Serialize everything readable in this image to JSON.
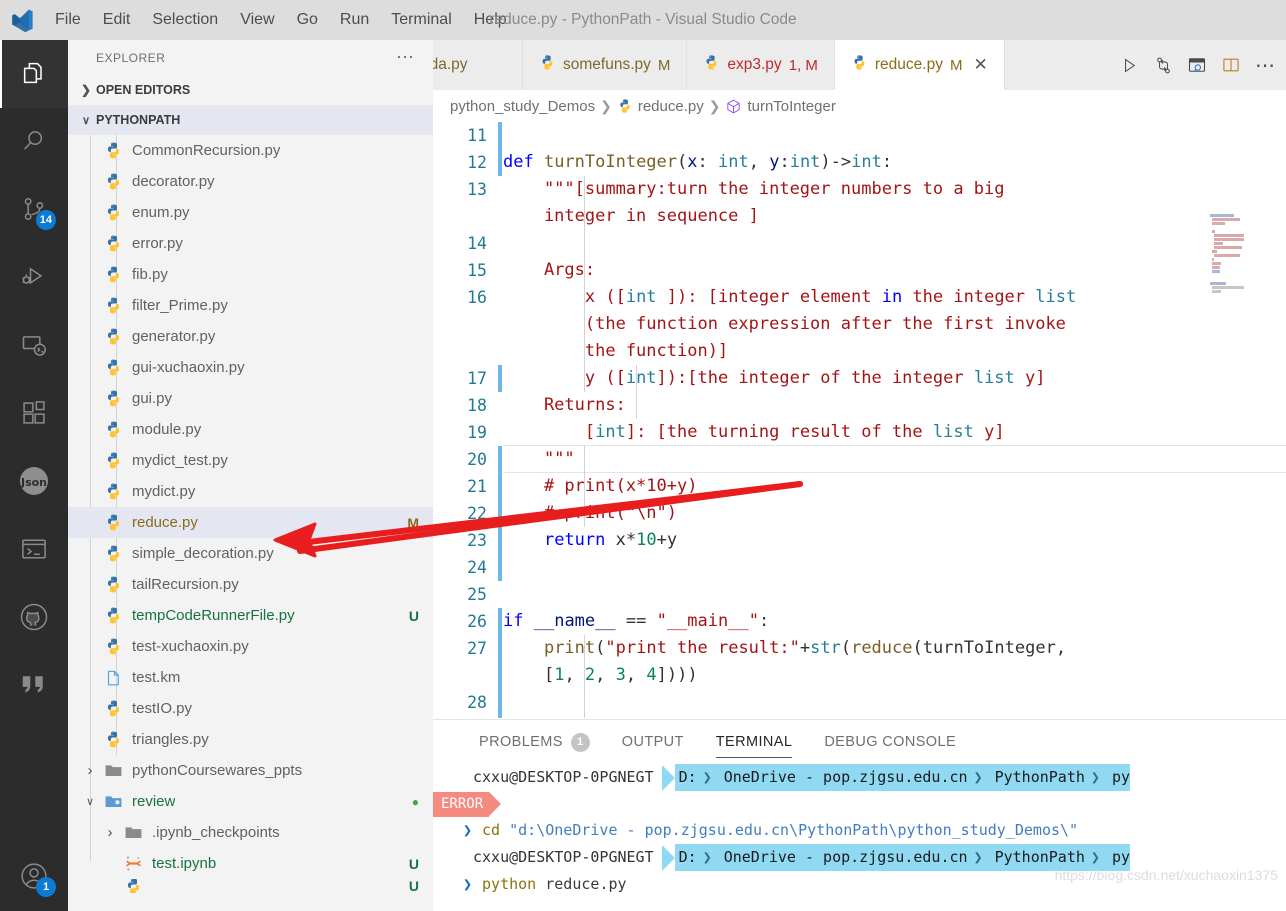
{
  "window": {
    "title": "reduce.py - PythonPath - Visual Studio Code",
    "logo_icon": "vscode-logo-icon"
  },
  "menubar": {
    "items": [
      {
        "label": "File"
      },
      {
        "label": "Edit"
      },
      {
        "label": "Selection"
      },
      {
        "label": "View"
      },
      {
        "label": "Go"
      },
      {
        "label": "Run"
      },
      {
        "label": "Terminal"
      },
      {
        "label": "Help"
      }
    ]
  },
  "activitybar": {
    "items": [
      {
        "icon": "files-explorer-icon",
        "active": true,
        "badge": ""
      },
      {
        "icon": "search-icon",
        "active": false,
        "badge": ""
      },
      {
        "icon": "source-control-icon",
        "active": false,
        "badge": "14"
      },
      {
        "icon": "run-and-debug-icon",
        "active": false,
        "badge": ""
      },
      {
        "icon": "remote-explorer-icon",
        "active": false,
        "badge": ""
      },
      {
        "icon": "extensions-icon",
        "active": false,
        "badge": ""
      },
      {
        "icon": "json-icon",
        "active": false,
        "badge": ""
      },
      {
        "icon": "terminal-icon",
        "active": false,
        "badge": ""
      },
      {
        "icon": "github-icon",
        "active": false,
        "badge": ""
      },
      {
        "icon": "quote-bookmarks-icon",
        "active": false,
        "badge": ""
      }
    ],
    "bottom": [
      {
        "icon": "accounts-icon",
        "badge": "1"
      }
    ]
  },
  "sidebar": {
    "header": "EXPLORER",
    "more_icon": "ellipsis-icon",
    "sections": [
      {
        "label": "OPEN EDITORS",
        "expanded": false
      },
      {
        "label": "PYTHONPATH",
        "expanded": true
      }
    ],
    "files": [
      {
        "name": "CommonRecursion.py",
        "icon": "python-file-icon",
        "badge": "",
        "state": "normal",
        "depth": 2,
        "type": "file"
      },
      {
        "name": "decorator.py",
        "icon": "python-file-icon",
        "badge": "",
        "state": "normal",
        "depth": 2,
        "type": "file"
      },
      {
        "name": "enum.py",
        "icon": "python-file-icon",
        "badge": "",
        "state": "normal",
        "depth": 2,
        "type": "file"
      },
      {
        "name": "error.py",
        "icon": "python-file-icon",
        "badge": "",
        "state": "normal",
        "depth": 2,
        "type": "file"
      },
      {
        "name": "fib.py",
        "icon": "python-file-icon",
        "badge": "",
        "state": "normal",
        "depth": 2,
        "type": "file"
      },
      {
        "name": "filter_Prime.py",
        "icon": "python-file-icon",
        "badge": "",
        "state": "normal",
        "depth": 2,
        "type": "file"
      },
      {
        "name": "generator.py",
        "icon": "python-file-icon",
        "badge": "",
        "state": "normal",
        "depth": 2,
        "type": "file"
      },
      {
        "name": "gui-xuchaoxin.py",
        "icon": "python-file-icon",
        "badge": "",
        "state": "normal",
        "depth": 2,
        "type": "file"
      },
      {
        "name": "gui.py",
        "icon": "python-file-icon",
        "badge": "",
        "state": "normal",
        "depth": 2,
        "type": "file"
      },
      {
        "name": "module.py",
        "icon": "python-file-icon",
        "badge": "",
        "state": "normal",
        "depth": 2,
        "type": "file"
      },
      {
        "name": "mydict_test.py",
        "icon": "python-file-icon",
        "badge": "",
        "state": "normal",
        "depth": 2,
        "type": "file"
      },
      {
        "name": "mydict.py",
        "icon": "python-file-icon",
        "badge": "",
        "state": "normal",
        "depth": 2,
        "type": "file"
      },
      {
        "name": "reduce.py",
        "icon": "python-file-icon",
        "badge": "M",
        "state": "modified",
        "depth": 2,
        "type": "file",
        "selected": true
      },
      {
        "name": "simple_decoration.py",
        "icon": "python-file-icon",
        "badge": "",
        "state": "normal",
        "depth": 2,
        "type": "file"
      },
      {
        "name": "tailRecursion.py",
        "icon": "python-file-icon",
        "badge": "",
        "state": "normal",
        "depth": 2,
        "type": "file"
      },
      {
        "name": "tempCodeRunnerFile.py",
        "icon": "python-file-icon",
        "badge": "U",
        "state": "untracked",
        "depth": 2,
        "type": "file"
      },
      {
        "name": "test-xuchaoxin.py",
        "icon": "python-file-icon",
        "badge": "",
        "state": "normal",
        "depth": 2,
        "type": "file"
      },
      {
        "name": "test.km",
        "icon": "generic-file-icon",
        "badge": "",
        "state": "normal",
        "depth": 2,
        "type": "file"
      },
      {
        "name": "testIO.py",
        "icon": "python-file-icon",
        "badge": "",
        "state": "normal",
        "depth": 2,
        "type": "file"
      },
      {
        "name": "triangles.py",
        "icon": "python-file-icon",
        "badge": "",
        "state": "normal",
        "depth": 2,
        "type": "file"
      },
      {
        "name": "pythonCoursewares_ppts",
        "icon": "folder-icon",
        "badge": "",
        "state": "normal",
        "depth": 1,
        "type": "folder",
        "expanded": false
      },
      {
        "name": "review",
        "icon": "folder-open-icon",
        "badge": "●",
        "state": "untracked",
        "depth": 1,
        "type": "folder",
        "expanded": true
      },
      {
        "name": ".ipynb_checkpoints",
        "icon": "folder-icon",
        "badge": "",
        "state": "normal",
        "depth": 2,
        "type": "folder",
        "expanded": false
      },
      {
        "name": "test.ipynb",
        "icon": "jupyter-file-icon",
        "badge": "U",
        "state": "untracked",
        "depth": 3,
        "type": "file"
      }
    ]
  },
  "tabs": [
    {
      "label": "bda.py",
      "icon": "",
      "badge": "",
      "active": false,
      "error": false
    },
    {
      "label": "somefuns.py",
      "icon": "python-file-icon",
      "badge": "M",
      "active": false,
      "error": false
    },
    {
      "label": "exp3.py",
      "icon": "python-file-icon",
      "badge": "1, M",
      "active": false,
      "error": true
    },
    {
      "label": "reduce.py",
      "icon": "python-file-icon",
      "badge": "M",
      "active": true,
      "error": false,
      "close_icon": "close-icon"
    }
  ],
  "editor_actions": [
    {
      "icon": "run-python-file-icon"
    },
    {
      "icon": "run-and-debug-icon"
    },
    {
      "icon": "open-preview-to-side-icon"
    },
    {
      "icon": "split-editor-right-icon"
    },
    {
      "icon": "more-actions-icon"
    }
  ],
  "breadcrumb": [
    {
      "label": "python_study_Demos",
      "icon": ""
    },
    {
      "label": "reduce.py",
      "icon": "python-file-icon"
    },
    {
      "label": "turnToInteger",
      "icon": "symbol-method-icon"
    }
  ],
  "code": {
    "first_line": 11,
    "current_line": 20,
    "lines": [
      {
        "num": "11",
        "text": "",
        "tokens": []
      },
      {
        "num": "12",
        "text": "def turnToInteger(x: int, y:int)->int:",
        "tokens": [
          {
            "t": "def ",
            "c": "kw"
          },
          {
            "t": "turnToInteger",
            "c": "fn"
          },
          {
            "t": "(",
            "c": "op"
          },
          {
            "t": "x",
            "c": "par"
          },
          {
            "t": ": ",
            "c": "op"
          },
          {
            "t": "int",
            "c": "typ"
          },
          {
            "t": ", ",
            "c": "op"
          },
          {
            "t": "y",
            "c": "par"
          },
          {
            "t": ":",
            "c": "op"
          },
          {
            "t": "int",
            "c": "typ"
          },
          {
            "t": ")->",
            "c": "op"
          },
          {
            "t": "int",
            "c": "typ"
          },
          {
            "t": ":",
            "c": "op"
          }
        ]
      },
      {
        "num": "13",
        "text": "    \"\"\"[summary:turn the integer numbers to a big",
        "tokens": [
          {
            "t": "    \"\"\"[summary:turn the integer numbers to a big",
            "c": "cmt"
          }
        ]
      },
      {
        "num": "",
        "text": "    integer in sequence ]",
        "tokens": [
          {
            "t": "    integer in sequence ]",
            "c": "cmt"
          }
        ]
      },
      {
        "num": "14",
        "text": "",
        "tokens": []
      },
      {
        "num": "15",
        "text": "    Args:",
        "tokens": [
          {
            "t": "    Args:",
            "c": "cmt"
          }
        ]
      },
      {
        "num": "16",
        "text": "        x ([int ]): [integer element in the integer list",
        "tokens": [
          {
            "t": "        x ([",
            "c": "cmt"
          },
          {
            "t": "int",
            "c": "typ"
          },
          {
            "t": " ]): [integer element ",
            "c": "cmt"
          },
          {
            "t": "in",
            "c": "kw"
          },
          {
            "t": " the integer ",
            "c": "cmt"
          },
          {
            "t": "list",
            "c": "typ"
          }
        ]
      },
      {
        "num": "",
        "text": "        (the function expression after the first invoke",
        "tokens": [
          {
            "t": "        (the function expression after the first invoke",
            "c": "cmt"
          }
        ]
      },
      {
        "num": "",
        "text": "        the function)]",
        "tokens": [
          {
            "t": "        the function)]",
            "c": "cmt"
          }
        ]
      },
      {
        "num": "17",
        "text": "        y ([int]):[the integer of the integer list y]",
        "tokens": [
          {
            "t": "        y ([",
            "c": "cmt"
          },
          {
            "t": "int",
            "c": "typ"
          },
          {
            "t": "]):[the integer of the integer ",
            "c": "cmt"
          },
          {
            "t": "list",
            "c": "typ"
          },
          {
            "t": " y]",
            "c": "cmt"
          }
        ]
      },
      {
        "num": "18",
        "text": "    Returns:",
        "tokens": [
          {
            "t": "    Returns:",
            "c": "cmt"
          }
        ]
      },
      {
        "num": "19",
        "text": "        [int]: [the turning result of the list y]",
        "tokens": [
          {
            "t": "        [",
            "c": "cmt"
          },
          {
            "t": "int",
            "c": "typ"
          },
          {
            "t": "]: [the turning result of the ",
            "c": "cmt"
          },
          {
            "t": "list",
            "c": "typ"
          },
          {
            "t": " y]",
            "c": "cmt"
          }
        ]
      },
      {
        "num": "20",
        "text": "    \"\"\"",
        "tokens": [
          {
            "t": "    \"\"\"",
            "c": "cmt"
          }
        ]
      },
      {
        "num": "21",
        "text": "    # print(x*10+y)",
        "tokens": [
          {
            "t": "    # print(x*10+y)",
            "c": "cmt"
          }
        ]
      },
      {
        "num": "22",
        "text": "    # print(\"\\n\")",
        "tokens": [
          {
            "t": "    # print(\"\\n\")",
            "c": "cmt"
          }
        ]
      },
      {
        "num": "23",
        "text": "    return x*10+y",
        "tokens": [
          {
            "t": "    ",
            "c": "op"
          },
          {
            "t": "return",
            "c": "kw"
          },
          {
            "t": " x",
            "c": "op"
          },
          {
            "t": "*",
            "c": "op"
          },
          {
            "t": "10",
            "c": "num"
          },
          {
            "t": "+y",
            "c": "op"
          }
        ]
      },
      {
        "num": "24",
        "text": "",
        "tokens": []
      },
      {
        "num": "25",
        "text": "",
        "tokens": []
      },
      {
        "num": "26",
        "text": "if __name__ == \"__main__\":",
        "tokens": [
          {
            "t": "if",
            "c": "kw"
          },
          {
            "t": " ",
            "c": "op"
          },
          {
            "t": "__name__",
            "c": "par"
          },
          {
            "t": " == ",
            "c": "op"
          },
          {
            "t": "\"__main__\"",
            "c": "str"
          },
          {
            "t": ":",
            "c": "op"
          }
        ]
      },
      {
        "num": "27",
        "text": "    print(\"print the result:\"+str(reduce(turnToInteger,",
        "tokens": [
          {
            "t": "    ",
            "c": "op"
          },
          {
            "t": "print",
            "c": "fn"
          },
          {
            "t": "(",
            "c": "op"
          },
          {
            "t": "\"print the result:\"",
            "c": "str"
          },
          {
            "t": "+",
            "c": "op"
          },
          {
            "t": "str",
            "c": "blt"
          },
          {
            "t": "(",
            "c": "op"
          },
          {
            "t": "reduce",
            "c": "fn"
          },
          {
            "t": "(",
            "c": "op"
          },
          {
            "t": "turnToInteger",
            "c": "op"
          },
          {
            "t": ",",
            "c": "op"
          }
        ]
      },
      {
        "num": "",
        "text": "    [1, 2, 3, 4])))",
        "tokens": [
          {
            "t": "    [",
            "c": "op"
          },
          {
            "t": "1",
            "c": "num"
          },
          {
            "t": ", ",
            "c": "op"
          },
          {
            "t": "2",
            "c": "num"
          },
          {
            "t": ", ",
            "c": "op"
          },
          {
            "t": "3",
            "c": "num"
          },
          {
            "t": ", ",
            "c": "op"
          },
          {
            "t": "4",
            "c": "num"
          },
          {
            "t": "])))",
            "c": "op"
          }
        ]
      },
      {
        "num": "28",
        "text": "",
        "tokens": []
      }
    ]
  },
  "panel": {
    "tabs": [
      {
        "label": "PROBLEMS",
        "badge": "1",
        "active": false
      },
      {
        "label": "OUTPUT",
        "badge": "",
        "active": false
      },
      {
        "label": "TERMINAL",
        "badge": "",
        "active": true
      },
      {
        "label": "DEBUG CONSOLE",
        "badge": "",
        "active": false
      }
    ],
    "terminal": {
      "user": "cxxu@DESKTOP-0PGNEGT",
      "path_segments": [
        "D:",
        "OneDrive - pop.zjgsu.edu.cn",
        "PythonPath",
        "py"
      ],
      "error_tag": "ERROR",
      "prompt": "❯",
      "command1_cmd": "cd",
      "command1_arg": "\"d:\\OneDrive - pop.zjgsu.edu.cn\\PythonPath\\python_study_Demos\\\"",
      "command2_cmd": "python",
      "command2_arg": "reduce.py"
    },
    "watermark": "https://blog.csdn.net/xuchaoxin1375"
  },
  "colors": {
    "accent_blue": "#0c7bd4",
    "powerline_blue": "#8fd9f2",
    "error_red": "#f58a80",
    "annotation_red": "#e81e1e",
    "modified_yellow": "#8a6c17",
    "untracked_green": "#17723f"
  },
  "annotation": {
    "type": "arrow",
    "label": "red-arrow-pointing-to-reduce-py",
    "color": "#e81e1e"
  }
}
